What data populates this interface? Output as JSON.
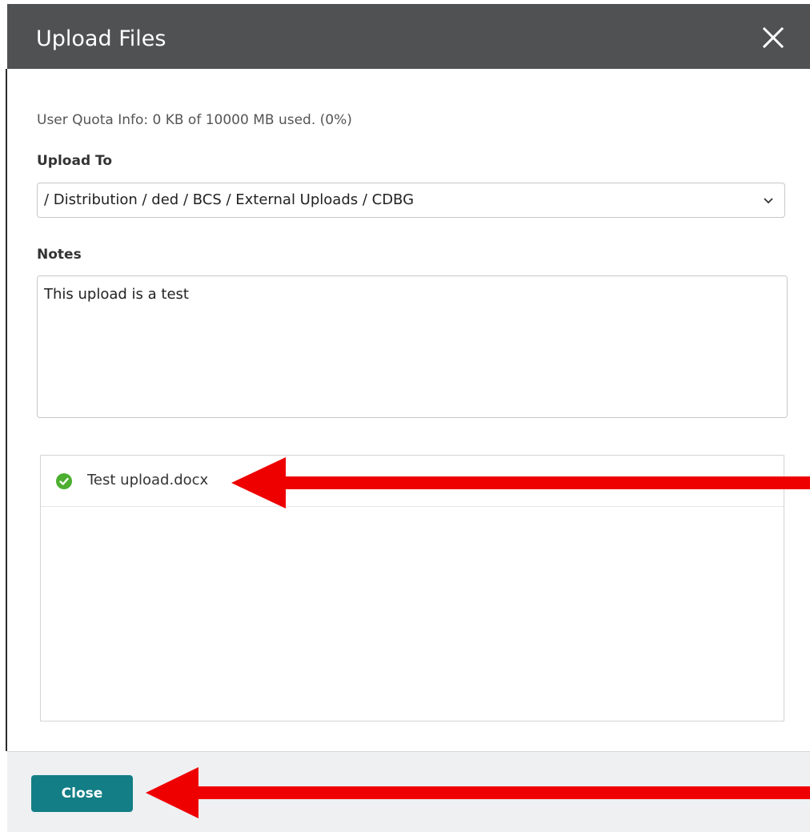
{
  "dialog": {
    "title": "Upload Files",
    "close_icon": "close-icon"
  },
  "quota": {
    "text": "User Quota Info: 0 KB of 10000 MB used. (0%)"
  },
  "upload_to": {
    "label": "Upload To",
    "selected": "/ Distribution / ded / BCS / External Uploads / CDBG",
    "icon": "chevron-down-icon"
  },
  "notes": {
    "label": "Notes",
    "value": "This upload is a test"
  },
  "files": [
    {
      "name": "Test upload.docx",
      "status_icon": "check-circle-icon"
    }
  ],
  "footer": {
    "close_label": "Close"
  },
  "colors": {
    "header_bg": "#505153",
    "button_bg": "#137e86",
    "success": "#4caf2f",
    "annotation_arrow": "#ee0000"
  }
}
